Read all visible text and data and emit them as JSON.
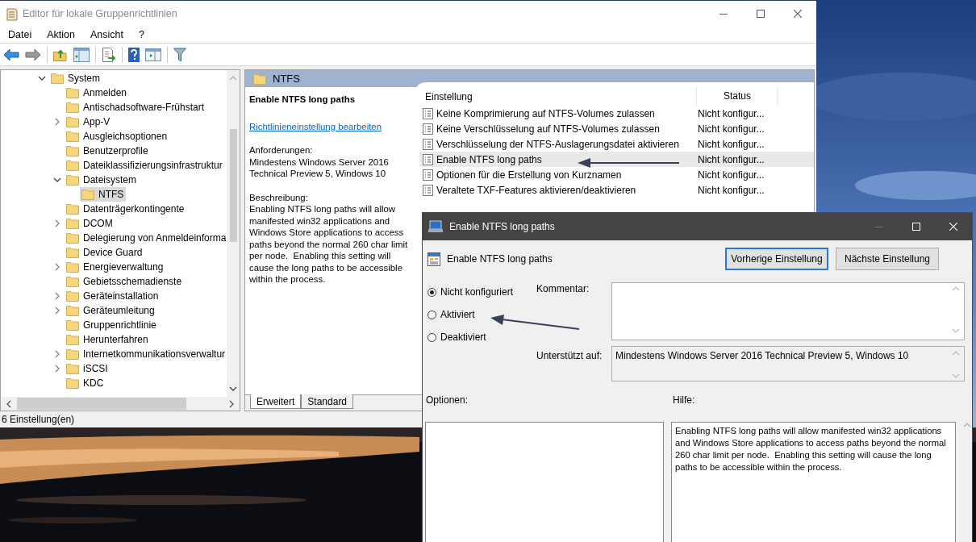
{
  "main_window": {
    "title": "Editor für lokale Gruppenrichtlinien",
    "menu": [
      "Datei",
      "Aktion",
      "Ansicht",
      "?"
    ],
    "tree": [
      {
        "label": "System",
        "expanded": true,
        "selected": false,
        "children": [
          {
            "label": "Anmelden",
            "selected": false
          },
          {
            "label": "Antischadsoftware-Frühstart",
            "selected": false
          },
          {
            "label": "App-V",
            "expanded": false,
            "selected": false
          },
          {
            "label": "Ausgleichsoptionen",
            "selected": false
          },
          {
            "label": "Benutzerprofile",
            "selected": false
          },
          {
            "label": "Dateiklassifizierungsinfrastruktur",
            "selected": false
          },
          {
            "label": "Dateisystem",
            "expanded": true,
            "selected": false,
            "children": [
              {
                "label": "NTFS",
                "selected": true
              }
            ]
          },
          {
            "label": "Datenträgerkontingente",
            "selected": false
          },
          {
            "label": "DCOM",
            "expanded": false,
            "selected": false
          },
          {
            "label": "Delegierung von Anmeldeinforma",
            "selected": false
          },
          {
            "label": "Device Guard",
            "selected": false
          },
          {
            "label": "Energieverwaltung",
            "expanded": false,
            "selected": false
          },
          {
            "label": "Gebietsschemadienste",
            "selected": false
          },
          {
            "label": "Geräteinstallation",
            "expanded": false,
            "selected": false
          },
          {
            "label": "Geräteumleitung",
            "expanded": false,
            "selected": false
          },
          {
            "label": "Gruppenrichtlinie",
            "selected": false
          },
          {
            "label": "Herunterfahren",
            "selected": false
          },
          {
            "label": "Internetkommunikationsverwaltur",
            "expanded": false,
            "selected": false
          },
          {
            "label": "iSCSI",
            "expanded": false,
            "selected": false
          },
          {
            "label": "KDC",
            "selected": false
          }
        ]
      }
    ],
    "details": {
      "header": "NTFS",
      "title": "Enable NTFS long paths",
      "link": "Richtlinieneinstellung bearbeiten",
      "requirements_label": "Anforderungen:",
      "requirements": "Mindestens Windows Server 2016 Technical Preview 5, Windows 10",
      "description_label": "Beschreibung:",
      "description": "Enabling NTFS long paths will allow manifested win32 applications and Windows Store applications to access paths beyond the normal 260 char limit per node.  Enabling this setting will cause the long paths to be accessible within the process."
    },
    "table": {
      "columns": [
        "Einstellung",
        "Status"
      ],
      "rows": [
        {
          "name": "Keine Komprimierung auf NTFS-Volumes zulassen",
          "status": "Nicht konfigur...",
          "selected": false
        },
        {
          "name": "Keine Verschlüsselung auf NTFS-Volumes zulassen",
          "status": "Nicht konfigur...",
          "selected": false
        },
        {
          "name": "Verschlüsselung der NTFS-Auslagerungsdatei aktivieren",
          "status": "Nicht konfigur...",
          "selected": false
        },
        {
          "name": "Enable NTFS long paths",
          "status": "Nicht konfigur...",
          "selected": true
        },
        {
          "name": "Optionen für die Erstellung von Kurznamen",
          "status": "Nicht konfigur...",
          "selected": false
        },
        {
          "name": "Veraltete TXF-Features aktivieren/deaktivieren",
          "status": "Nicht konfigur...",
          "selected": false
        }
      ]
    },
    "tabs": [
      {
        "label": "Erweitert",
        "selected": true
      },
      {
        "label": "Standard",
        "selected": false
      }
    ],
    "status_bar": "6 Einstellung(en)"
  },
  "dialog": {
    "title": "Enable NTFS long paths",
    "setting": "Enable NTFS long paths",
    "buttons": [
      {
        "label": "Vorherige Einstellung",
        "focused": true
      },
      {
        "label": "Nächste Einstellung",
        "focused": false
      }
    ],
    "options": [
      {
        "label": "Nicht konfiguriert",
        "selected": true
      },
      {
        "label": "Aktiviert",
        "selected": false
      },
      {
        "label": "Deaktiviert",
        "selected": false
      }
    ],
    "comment_label": "Kommentar:",
    "supported_label": "Unterstützt auf:",
    "supported": "Mindestens Windows Server 2016 Technical Preview 5, Windows 10",
    "options_label": "Optionen:",
    "help_label": "Hilfe:",
    "help": "Enabling NTFS long paths will allow manifested win32 applications and Windows Store applications to access paths beyond the normal 260 char limit per node.  Enabling this setting will cause the long paths to be accessible within the process."
  }
}
